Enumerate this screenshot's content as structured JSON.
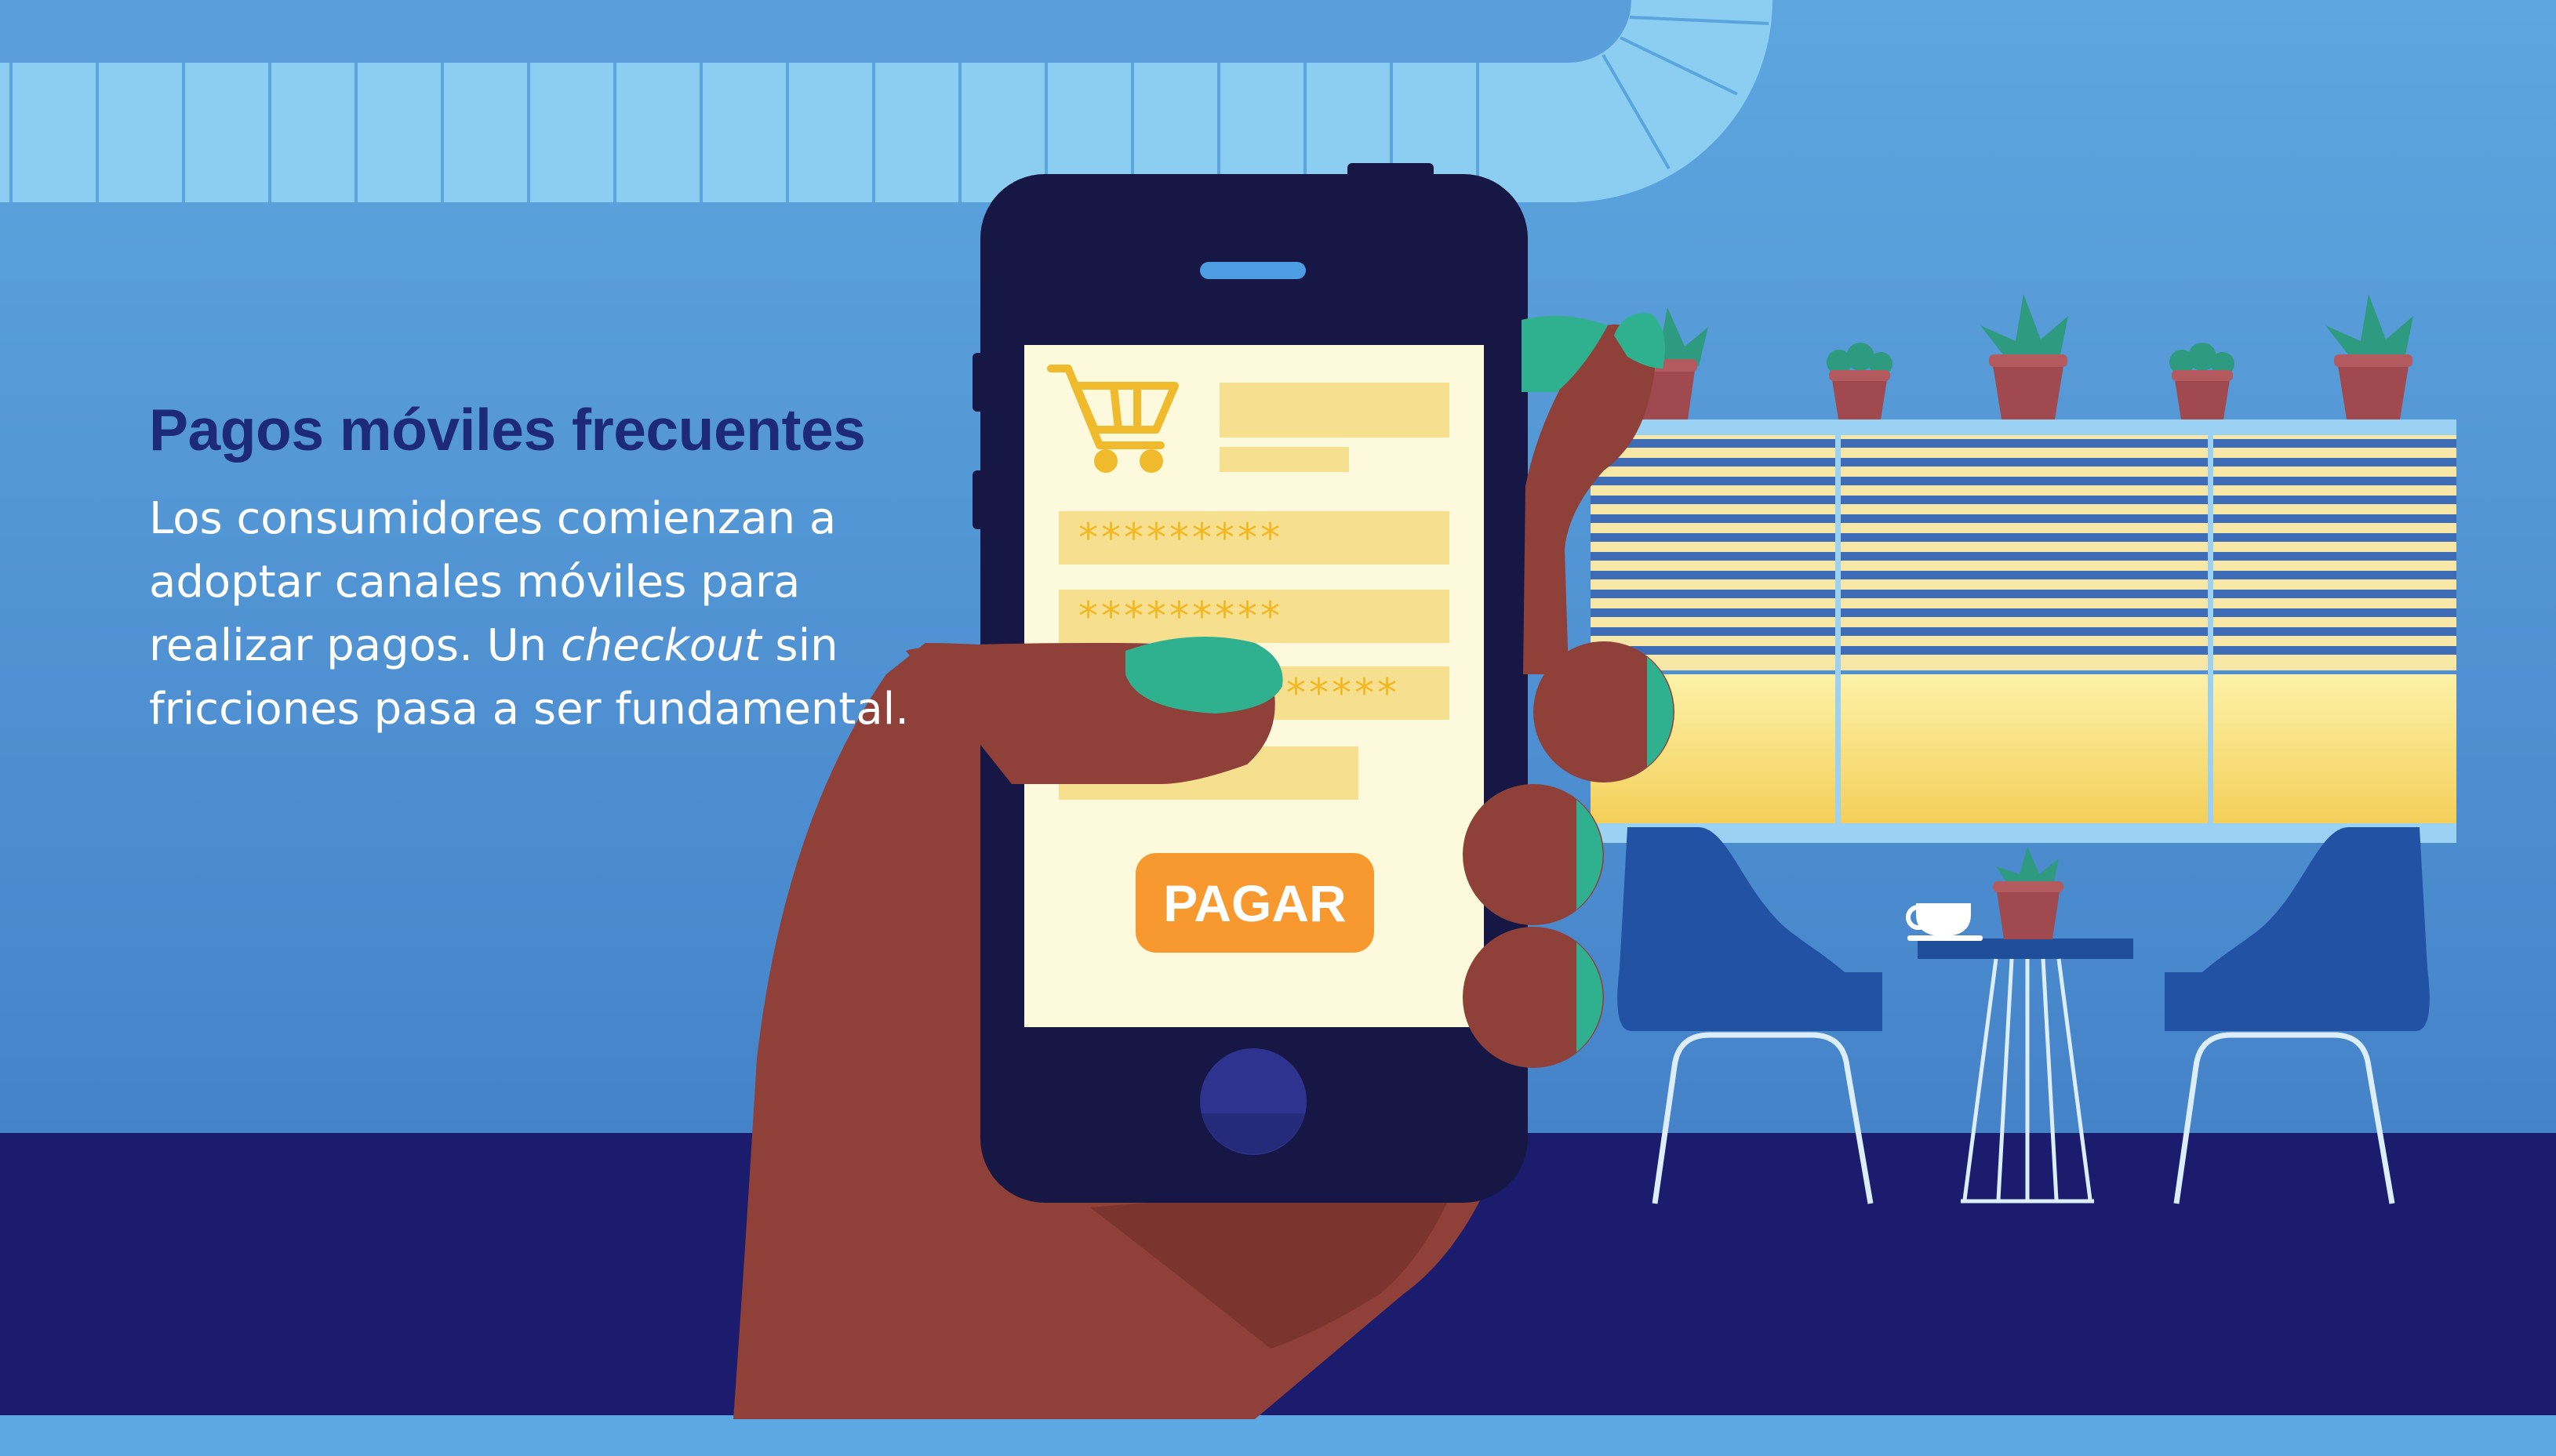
{
  "card": {
    "title": "Pagos móviles frecuentes",
    "body_part1": "Los consumidores comienzan a adoptar canales móviles para realizar pagos. Un ",
    "body_emphasis": "checkout",
    "body_part2": " sin fricciones pasa a ser fundamental."
  },
  "phone_screen": {
    "card_number_mask": "*********",
    "card_expiry_mask": "*********",
    "cvv_mask": "*****",
    "pay_button_label": "PAGAR",
    "cart_icon": "shopping-cart-icon"
  },
  "colors": {
    "sky": "#5a9fdb",
    "floor": "#1b1c6e",
    "heading": "#1d2a7a",
    "phone_body": "#161744",
    "screen_bg": "#fdf9dc",
    "field_yellow": "#f7df90",
    "star_gold": "#f2b822",
    "pay_button": "#f7992e",
    "skin": "#8f4038",
    "nail_green": "#2fb18f",
    "chair_blue": "#2152a4"
  }
}
